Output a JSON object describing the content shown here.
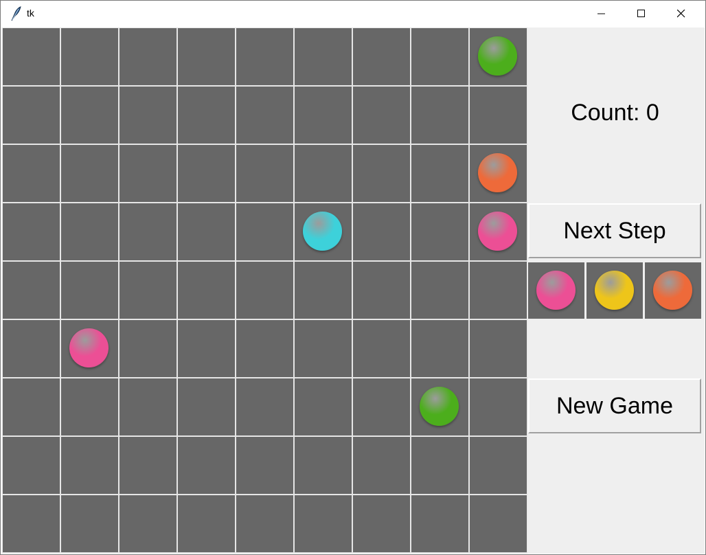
{
  "window": {
    "title": "tk"
  },
  "board": {
    "rows": 9,
    "cols": 9,
    "balls": [
      {
        "row": 0,
        "col": 8,
        "color": "green"
      },
      {
        "row": 2,
        "col": 8,
        "color": "orange"
      },
      {
        "row": 3,
        "col": 5,
        "color": "cyan"
      },
      {
        "row": 3,
        "col": 8,
        "color": "pink"
      },
      {
        "row": 5,
        "col": 1,
        "color": "pink"
      },
      {
        "row": 6,
        "col": 7,
        "color": "green"
      }
    ]
  },
  "side": {
    "count_label": "Count: 0",
    "next_step_label": "Next Step",
    "new_game_label": "New Game",
    "next_balls": [
      "pink",
      "yellow",
      "orange"
    ]
  },
  "colors": {
    "cell": "#676767",
    "grid_line": "#e6e6e6",
    "panel": "#efefef",
    "green": "#4cae1c",
    "orange": "#ee6a3a",
    "cyan": "#3dd1da",
    "pink": "#ec4f95",
    "yellow": "#eec51a"
  }
}
